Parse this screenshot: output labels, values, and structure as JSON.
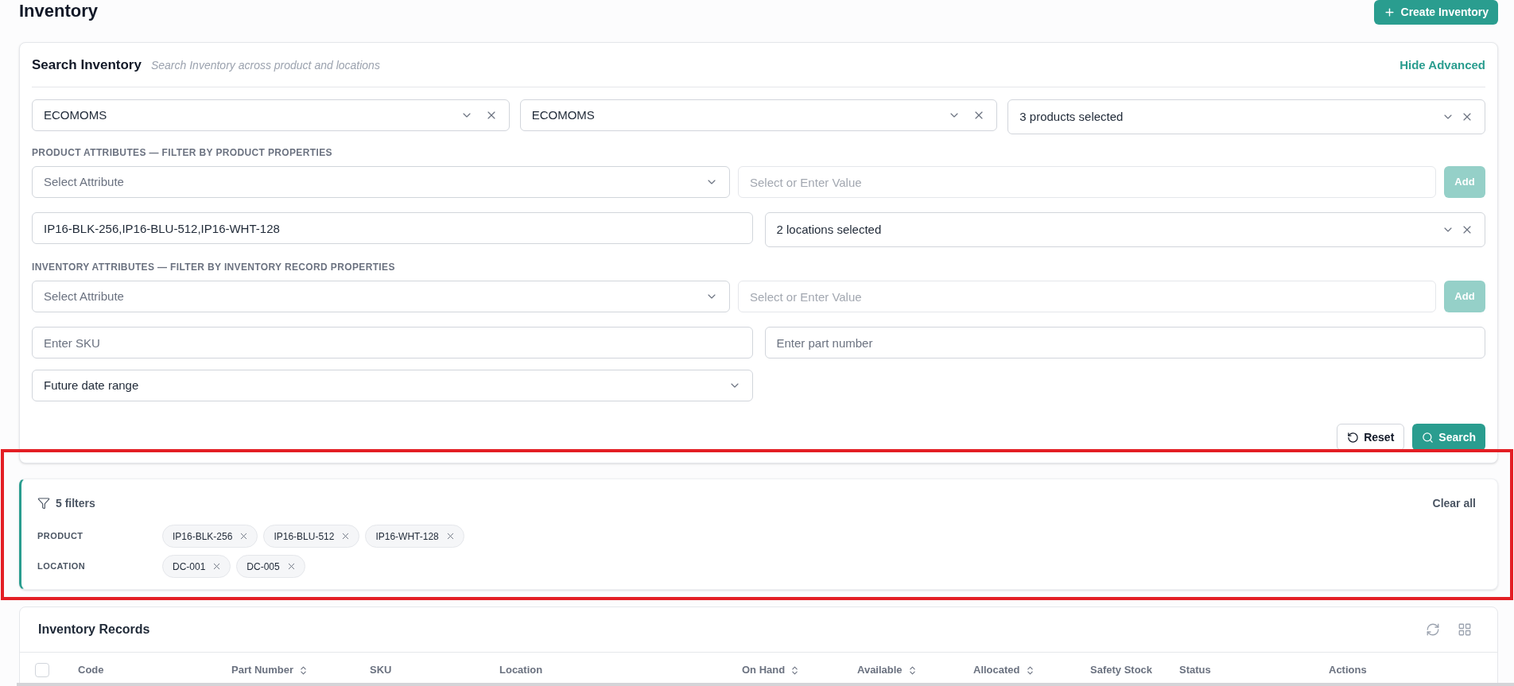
{
  "page": {
    "title": "Inventory",
    "create_button": "Create Inventory"
  },
  "search_panel": {
    "title": "Search Inventory",
    "subtitle": "Search Inventory across product and locations",
    "toggle_link": "Hide Advanced",
    "top_selects": [
      {
        "kind": "single",
        "value": "ECOMOMS",
        "clearable": true
      },
      {
        "kind": "single",
        "value": "ECOMOMS",
        "clearable": true
      },
      {
        "kind": "multi",
        "value": "3 products selected",
        "clearable": true
      }
    ],
    "product_attributes": {
      "heading": "PRODUCT ATTRIBUTES — FILTER BY PRODUCT PROPERTIES",
      "attribute_select": {
        "placeholder": "Select Attribute"
      },
      "value_field": {
        "placeholder": "Select or Enter Value"
      },
      "add_button": {
        "label": "Add",
        "disabled": true
      }
    },
    "product_codes_field": {
      "value": "IP16-BLK-256,IP16-BLU-512,IP16-WHT-128"
    },
    "locations_select": {
      "kind": "multi",
      "value": "2 locations selected",
      "clearable": true
    },
    "inventory_attributes": {
      "heading": "INVENTORY ATTRIBUTES — FILTER BY INVENTORY RECORD PROPERTIES",
      "attribute_select": {
        "placeholder": "Select Attribute"
      },
      "value_field": {
        "placeholder": "Select or Enter Value"
      },
      "add_button": {
        "label": "Add",
        "disabled": true
      }
    },
    "sku_field": {
      "placeholder": "Enter SKU"
    },
    "part_number_field": {
      "placeholder": "Enter part number"
    },
    "date_range_select": {
      "value": "Future date range"
    },
    "actions": [
      {
        "kind": "reset",
        "label": "Reset"
      },
      {
        "kind": "search",
        "label": "Search"
      }
    ]
  },
  "active_filters": {
    "count_label": "5 filters",
    "clear_link": "Clear all",
    "groups": [
      {
        "label": "PRODUCT",
        "chips": [
          "IP16-BLK-256",
          "IP16-BLU-512",
          "IP16-WHT-128"
        ]
      },
      {
        "label": "LOCATION",
        "chips": [
          "DC-001",
          "DC-005"
        ]
      }
    ]
  },
  "inventory_records": {
    "title": "Inventory Records",
    "select_all": {
      "checked": false
    },
    "columns": [
      {
        "label": "Code",
        "sortable": false
      },
      {
        "label": "Part Number",
        "sortable": true
      },
      {
        "label": "SKU",
        "sortable": false
      },
      {
        "label": "Location",
        "sortable": false
      },
      {
        "label": "On Hand",
        "sortable": true
      },
      {
        "label": "Available",
        "sortable": true
      },
      {
        "label": "Allocated",
        "sortable": true
      },
      {
        "label": "Safety Stock",
        "sortable": false
      },
      {
        "label": "Status",
        "sortable": false
      },
      {
        "label": "Actions",
        "sortable": false
      }
    ]
  },
  "annotations": [
    {
      "kind": "highlight_box"
    }
  ]
}
